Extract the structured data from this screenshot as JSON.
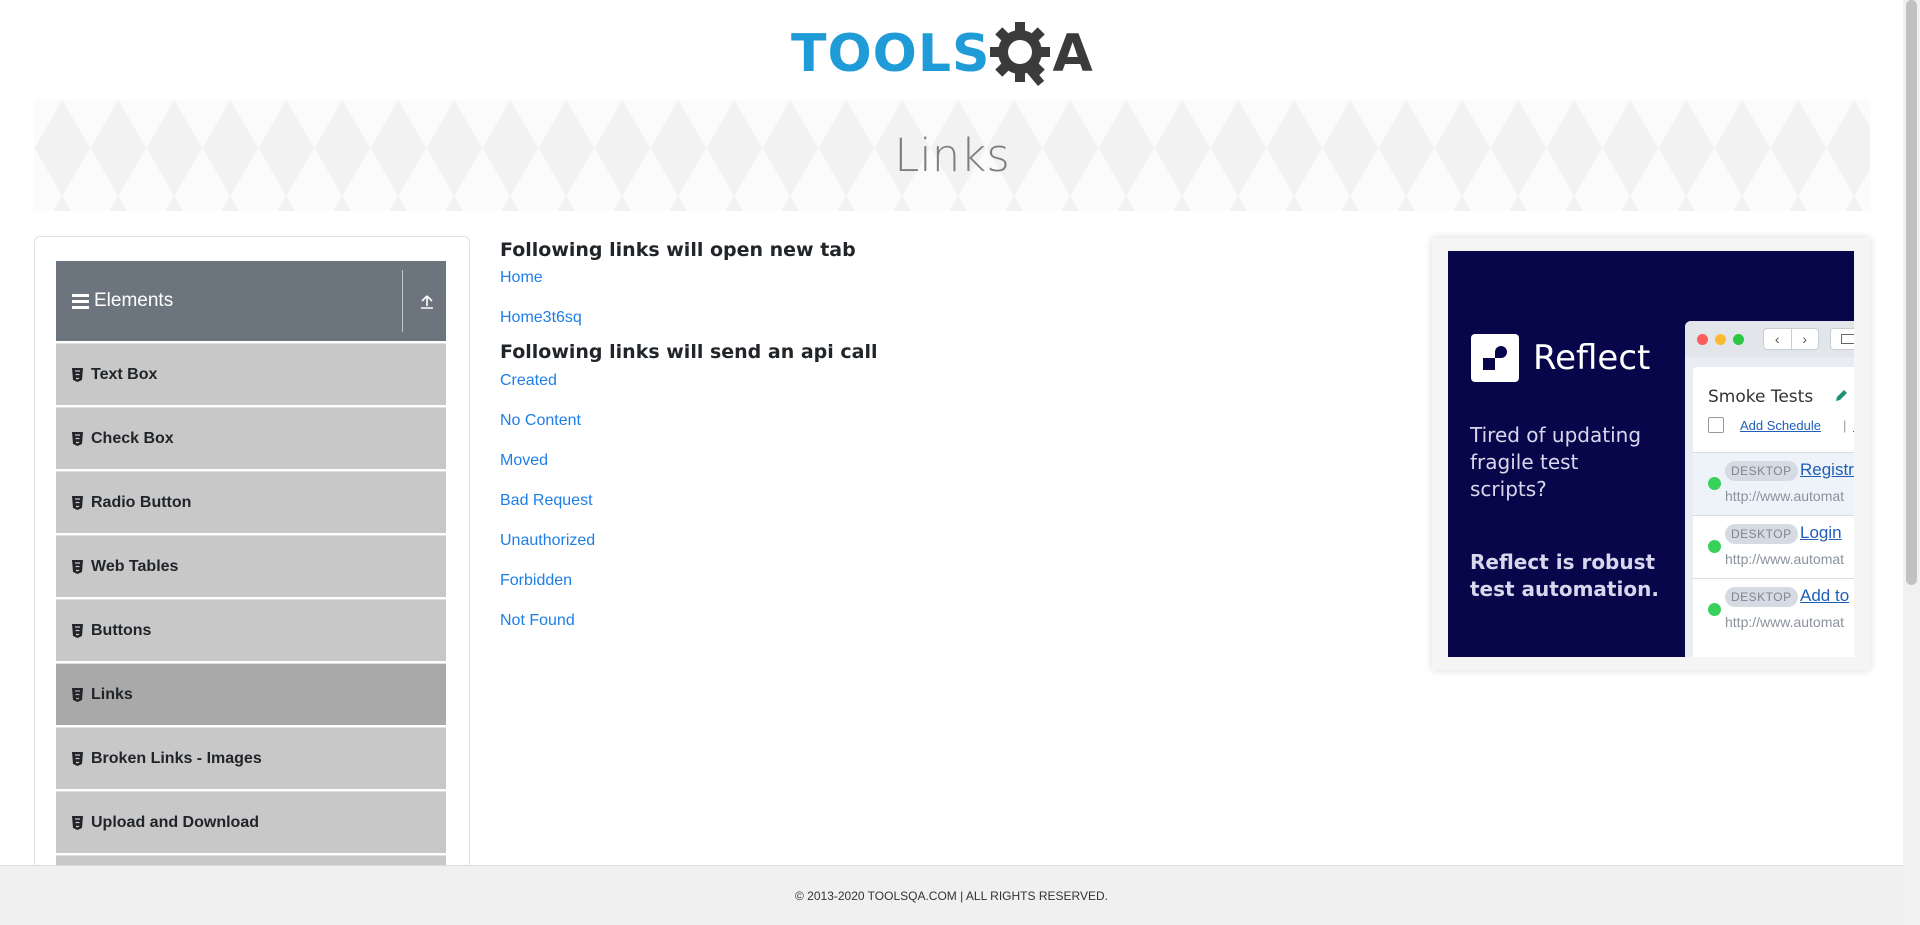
{
  "brand": {
    "logo_text_a": "TOOLS",
    "logo_text_b": "A",
    "primary": "#1f9bd7",
    "dark": "#3b3b3b"
  },
  "banner": {
    "title": "Links"
  },
  "sidebar": {
    "group_title": "Elements",
    "items": [
      {
        "label": "Text Box"
      },
      {
        "label": "Check Box"
      },
      {
        "label": "Radio Button"
      },
      {
        "label": "Web Tables"
      },
      {
        "label": "Buttons"
      },
      {
        "label": "Links",
        "active": true
      },
      {
        "label": "Broken Links - Images"
      },
      {
        "label": "Upload and Download"
      }
    ]
  },
  "main": {
    "section1_title": "Following links will open new tab",
    "new_tab_links": [
      "Home",
      "Home3t6sq"
    ],
    "section2_title": "Following links will send an api call",
    "api_links": [
      "Created",
      "No Content",
      "Moved",
      "Bad Request",
      "Unauthorized",
      "Forbidden",
      "Not Found"
    ],
    "link_color": "#1e7ee7"
  },
  "ad": {
    "brand": "Reflect",
    "tagline": "Tired of updating fragile test scripts?",
    "subline": "Reflect is robust test automation.",
    "panel_title": "Smoke Tests",
    "add_schedule": "Add Schedule",
    "separator": "|",
    "run": "Ru",
    "rows": [
      {
        "badge": "DESKTOP",
        "link": "Registr",
        "url": "http://www.automat"
      },
      {
        "badge": "DESKTOP",
        "link": "Login",
        "url": "http://www.automat"
      },
      {
        "badge": "DESKTOP",
        "link": "Add to",
        "url": "http://www.automat"
      }
    ],
    "background": "#08064a"
  },
  "footer": {
    "text": "© 2013-2020 TOOLSQA.COM | ALL RIGHTS RESERVED."
  }
}
